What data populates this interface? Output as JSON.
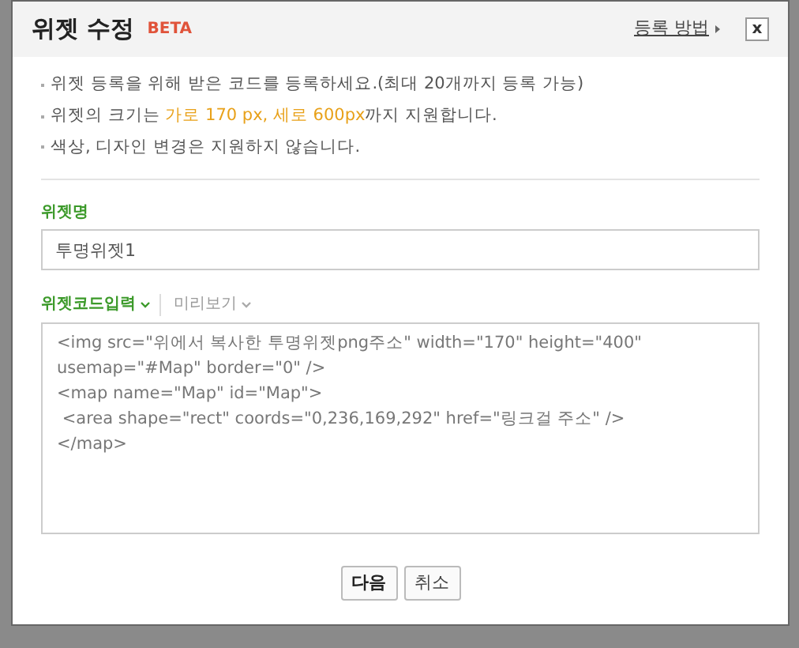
{
  "dialog": {
    "title": "위젯 수정",
    "badge": "BETA",
    "help_link": "등록 방법",
    "close": "x"
  },
  "notices": [
    [
      {
        "text": "위젯 등록을 위해 받은 코드를 등록하세요.(최대 20개까지 등록 가능)",
        "highlight": false
      }
    ],
    [
      {
        "text": "위젯의 크기는 ",
        "highlight": false
      },
      {
        "text": "가로 170 px, 세로 600px",
        "highlight": true
      },
      {
        "text": "까지 지원합니다.",
        "highlight": false
      }
    ],
    [
      {
        "text": "색상, 디자인 변경은 지원하지 않습니다.",
        "highlight": false
      }
    ]
  ],
  "name_field": {
    "label": "위젯명",
    "value": "투명위젯1"
  },
  "tabs": [
    {
      "label": "위젯코드입력",
      "selected": true
    },
    {
      "label": "미리보기",
      "selected": false
    }
  ],
  "code_lines": [
    "<img src=\"위에서 복사한 투명위젯png주소\" width=\"170\" height=\"400\"",
    "usemap=\"#Map\" border=\"0\" />",
    "<map name=\"Map\" id=\"Map\">",
    " <area shape=\"rect\" coords=\"0,236,169,292\" href=\"링크걸 주소\" />",
    "</map>"
  ],
  "buttons": [
    {
      "label": "다음",
      "primary": true
    },
    {
      "label": "취소",
      "primary": false
    }
  ]
}
